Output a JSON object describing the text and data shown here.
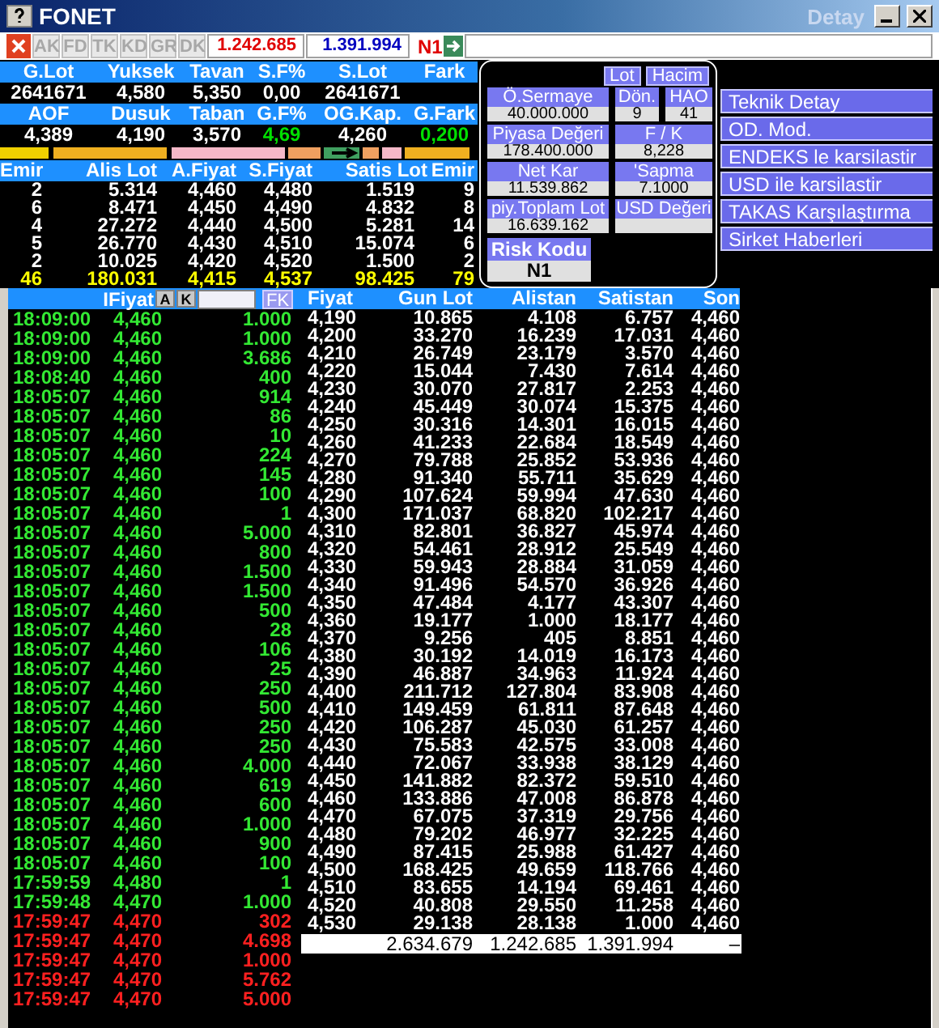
{
  "window": {
    "title": "FONET",
    "detail_title": "Detay"
  },
  "toolbar": {
    "buttons": [
      {
        "label": "AK",
        "disabled": true
      },
      {
        "label": "FD",
        "disabled": true
      },
      {
        "label": "TK",
        "disabled": true
      },
      {
        "label": "KD",
        "disabled": true
      },
      {
        "label": "GR",
        "disabled": true
      },
      {
        "label": "DK",
        "disabled": true
      }
    ],
    "buy_total": "1.242.685",
    "sell_total": "1.391.994",
    "risk": "N1"
  },
  "summary": [
    {
      "labels": [
        "G.Lot",
        "Yuksek",
        "Tavan",
        "S.F%",
        "S.Lot",
        "Fark"
      ],
      "values": [
        {
          "text": "2641671",
          "up": false
        },
        {
          "text": "4,580",
          "up": false
        },
        {
          "text": "5,350",
          "up": false
        },
        {
          "text": "0,00",
          "up": false
        },
        {
          "text": "2641671",
          "up": false
        }
      ]
    },
    {
      "labels": [
        "AOF",
        "Dusuk",
        "Taban",
        "G.F%",
        "OG.Kap.",
        "G.Fark"
      ],
      "values": [
        {
          "text": "4,389",
          "up": false
        },
        {
          "text": "4,190",
          "up": false
        },
        {
          "text": "3,570",
          "up": false
        },
        {
          "text": "4,69",
          "up": true
        },
        {
          "text": "4,260",
          "up": false
        },
        {
          "text": "0,200",
          "up": true
        }
      ]
    }
  ],
  "order_book": {
    "columns": [
      "Emir",
      "Alis Lot",
      "A.Fiyat",
      "S.Fiyat",
      "Satis Lot",
      "Emir"
    ],
    "rows": [
      {
        "kind": "level",
        "cells": [
          "2",
          "5.314",
          "4,460",
          "4,480",
          "1.519",
          "9"
        ]
      },
      {
        "kind": "level",
        "cells": [
          "6",
          "8.471",
          "4,450",
          "4,490",
          "4.832",
          "8"
        ]
      },
      {
        "kind": "level",
        "cells": [
          "4",
          "27.272",
          "4,440",
          "4,500",
          "5.281",
          "14"
        ]
      },
      {
        "kind": "level",
        "cells": [
          "5",
          "26.770",
          "4,430",
          "4,510",
          "15.074",
          "6"
        ]
      },
      {
        "kind": "level",
        "cells": [
          "2",
          "10.025",
          "4,420",
          "4,520",
          "1.500",
          "2"
        ]
      },
      {
        "kind": "total",
        "cells": [
          "46",
          "180.031",
          "4,415",
          "4,537",
          "98.425",
          "79"
        ]
      }
    ]
  },
  "detail": {
    "buttons": [
      "Lot",
      "Hacim"
    ],
    "rows": [
      [
        {
          "label": "Ö.Sermaye",
          "value": "40.000.000"
        },
        {
          "label": "Dön.",
          "value": "9"
        },
        {
          "label": "HAO",
          "value": "41"
        }
      ],
      [
        {
          "label": "Piyasa Değeri",
          "value": "178.400.000"
        },
        {
          "label": "F / K",
          "value": "8,228"
        }
      ],
      [
        {
          "label": "Net Kar",
          "value": "11.539.862"
        },
        {
          "label": "'Sapma",
          "value": "7.1000"
        }
      ],
      [
        {
          "label": "piy.Toplam Lot",
          "value": "16.639.162"
        },
        {
          "label": "USD Değeri"
        }
      ]
    ],
    "risk": {
      "label": "Risk Kodu",
      "value": "N1"
    }
  },
  "menu": [
    "Teknik Detay",
    "OD. Mod.",
    "ENDEKS le karsilastir",
    "USD ile karsilastir",
    "TAKAS Karşılaştırma",
    "Sirket Haberleri"
  ],
  "trades": {
    "header": {
      "label": "IFiyat",
      "buttons": [
        "A",
        "K"
      ],
      "fk": "FK"
    },
    "rows": [
      {
        "time": "18:09:00",
        "price": "4,460",
        "lot": "1.000",
        "kind": "buy"
      },
      {
        "time": "18:09:00",
        "price": "4,460",
        "lot": "1.000",
        "kind": "buy"
      },
      {
        "time": "18:09:00",
        "price": "4,460",
        "lot": "3.686",
        "kind": "buy"
      },
      {
        "time": "18:08:40",
        "price": "4,460",
        "lot": "400",
        "kind": "buy"
      },
      {
        "time": "18:05:07",
        "price": "4,460",
        "lot": "914",
        "kind": "buy"
      },
      {
        "time": "18:05:07",
        "price": "4,460",
        "lot": "86",
        "kind": "buy"
      },
      {
        "time": "18:05:07",
        "price": "4,460",
        "lot": "10",
        "kind": "buy"
      },
      {
        "time": "18:05:07",
        "price": "4,460",
        "lot": "224",
        "kind": "buy"
      },
      {
        "time": "18:05:07",
        "price": "4,460",
        "lot": "145",
        "kind": "buy"
      },
      {
        "time": "18:05:07",
        "price": "4,460",
        "lot": "100",
        "kind": "buy"
      },
      {
        "time": "18:05:07",
        "price": "4,460",
        "lot": "1",
        "kind": "buy"
      },
      {
        "time": "18:05:07",
        "price": "4,460",
        "lot": "5.000",
        "kind": "buy"
      },
      {
        "time": "18:05:07",
        "price": "4,460",
        "lot": "800",
        "kind": "buy"
      },
      {
        "time": "18:05:07",
        "price": "4,460",
        "lot": "1.500",
        "kind": "buy"
      },
      {
        "time": "18:05:07",
        "price": "4,460",
        "lot": "1.500",
        "kind": "buy"
      },
      {
        "time": "18:05:07",
        "price": "4,460",
        "lot": "500",
        "kind": "buy"
      },
      {
        "time": "18:05:07",
        "price": "4,460",
        "lot": "28",
        "kind": "buy"
      },
      {
        "time": "18:05:07",
        "price": "4,460",
        "lot": "106",
        "kind": "buy"
      },
      {
        "time": "18:05:07",
        "price": "4,460",
        "lot": "25",
        "kind": "buy"
      },
      {
        "time": "18:05:07",
        "price": "4,460",
        "lot": "250",
        "kind": "buy"
      },
      {
        "time": "18:05:07",
        "price": "4,460",
        "lot": "500",
        "kind": "buy"
      },
      {
        "time": "18:05:07",
        "price": "4,460",
        "lot": "250",
        "kind": "buy"
      },
      {
        "time": "18:05:07",
        "price": "4,460",
        "lot": "250",
        "kind": "buy"
      },
      {
        "time": "18:05:07",
        "price": "4,460",
        "lot": "4.000",
        "kind": "buy"
      },
      {
        "time": "18:05:07",
        "price": "4,460",
        "lot": "619",
        "kind": "buy"
      },
      {
        "time": "18:05:07",
        "price": "4,460",
        "lot": "600",
        "kind": "buy"
      },
      {
        "time": "18:05:07",
        "price": "4,460",
        "lot": "1.000",
        "kind": "buy"
      },
      {
        "time": "18:05:07",
        "price": "4,460",
        "lot": "900",
        "kind": "buy"
      },
      {
        "time": "18:05:07",
        "price": "4,460",
        "lot": "100",
        "kind": "buy"
      },
      {
        "time": "17:59:59",
        "price": "4,480",
        "lot": "1",
        "kind": "buy"
      },
      {
        "time": "17:59:48",
        "price": "4,470",
        "lot": "1.000",
        "kind": "buy"
      },
      {
        "time": "17:59:47",
        "price": "4,470",
        "lot": "302",
        "kind": "sell"
      },
      {
        "time": "17:59:47",
        "price": "4,470",
        "lot": "4.698",
        "kind": "sell"
      },
      {
        "time": "17:59:47",
        "price": "4,470",
        "lot": "1.000",
        "kind": "sell"
      },
      {
        "time": "17:59:47",
        "price": "4,470",
        "lot": "5.762",
        "kind": "sell"
      },
      {
        "time": "17:59:47",
        "price": "4,470",
        "lot": "5.000",
        "kind": "sell"
      }
    ]
  },
  "price_table": {
    "columns": [
      "Fiyat",
      "Gun Lot",
      "Alistan",
      "Satistan",
      "Son"
    ],
    "rows": [
      [
        "4,190",
        "10.865",
        "4.108",
        "6.757",
        "4,460"
      ],
      [
        "4,200",
        "33.270",
        "16.239",
        "17.031",
        "4,460"
      ],
      [
        "4,210",
        "26.749",
        "23.179",
        "3.570",
        "4,460"
      ],
      [
        "4,220",
        "15.044",
        "7.430",
        "7.614",
        "4,460"
      ],
      [
        "4,230",
        "30.070",
        "27.817",
        "2.253",
        "4,460"
      ],
      [
        "4,240",
        "45.449",
        "30.074",
        "15.375",
        "4,460"
      ],
      [
        "4,250",
        "30.316",
        "14.301",
        "16.015",
        "4,460"
      ],
      [
        "4,260",
        "41.233",
        "22.684",
        "18.549",
        "4,460"
      ],
      [
        "4,270",
        "79.788",
        "25.852",
        "53.936",
        "4,460"
      ],
      [
        "4,280",
        "91.340",
        "55.711",
        "35.629",
        "4,460"
      ],
      [
        "4,290",
        "107.624",
        "59.994",
        "47.630",
        "4,460"
      ],
      [
        "4,300",
        "171.037",
        "68.820",
        "102.217",
        "4,460"
      ],
      [
        "4,310",
        "82.801",
        "36.827",
        "45.974",
        "4,460"
      ],
      [
        "4,320",
        "54.461",
        "28.912",
        "25.549",
        "4,460"
      ],
      [
        "4,330",
        "59.943",
        "28.884",
        "31.059",
        "4,460"
      ],
      [
        "4,340",
        "91.496",
        "54.570",
        "36.926",
        "4,460"
      ],
      [
        "4,350",
        "47.484",
        "4.177",
        "43.307",
        "4,460"
      ],
      [
        "4,360",
        "19.177",
        "1.000",
        "18.177",
        "4,460"
      ],
      [
        "4,370",
        "9.256",
        "405",
        "8.851",
        "4,460"
      ],
      [
        "4,380",
        "30.192",
        "14.019",
        "16.173",
        "4,460"
      ],
      [
        "4,390",
        "46.887",
        "34.963",
        "11.924",
        "4,460"
      ],
      [
        "4,400",
        "211.712",
        "127.804",
        "83.908",
        "4,460"
      ],
      [
        "4,410",
        "149.459",
        "61.811",
        "87.648",
        "4,460"
      ],
      [
        "4,420",
        "106.287",
        "45.030",
        "61.257",
        "4,460"
      ],
      [
        "4,430",
        "75.583",
        "42.575",
        "33.008",
        "4,460"
      ],
      [
        "4,440",
        "72.067",
        "33.938",
        "38.129",
        "4,460"
      ],
      [
        "4,450",
        "141.882",
        "82.372",
        "59.510",
        "4,460"
      ],
      [
        "4,460",
        "133.886",
        "47.008",
        "86.878",
        "4,460"
      ],
      [
        "4,470",
        "67.075",
        "37.319",
        "29.756",
        "4,460"
      ],
      [
        "4,480",
        "79.202",
        "46.977",
        "32.225",
        "4,460"
      ],
      [
        "4,490",
        "87.415",
        "25.988",
        "61.427",
        "4,460"
      ],
      [
        "4,500",
        "168.425",
        "49.659",
        "118.766",
        "4,460"
      ],
      [
        "4,510",
        "83.655",
        "14.194",
        "69.461",
        "4,460"
      ],
      [
        "4,520",
        "40.808",
        "29.550",
        "11.258",
        "4,460"
      ],
      [
        "4,530",
        "29.138",
        "28.138",
        "1.000",
        "4,460"
      ]
    ],
    "totals": [
      "2.634.679",
      "1.242.685",
      "1.391.994",
      "–"
    ]
  }
}
